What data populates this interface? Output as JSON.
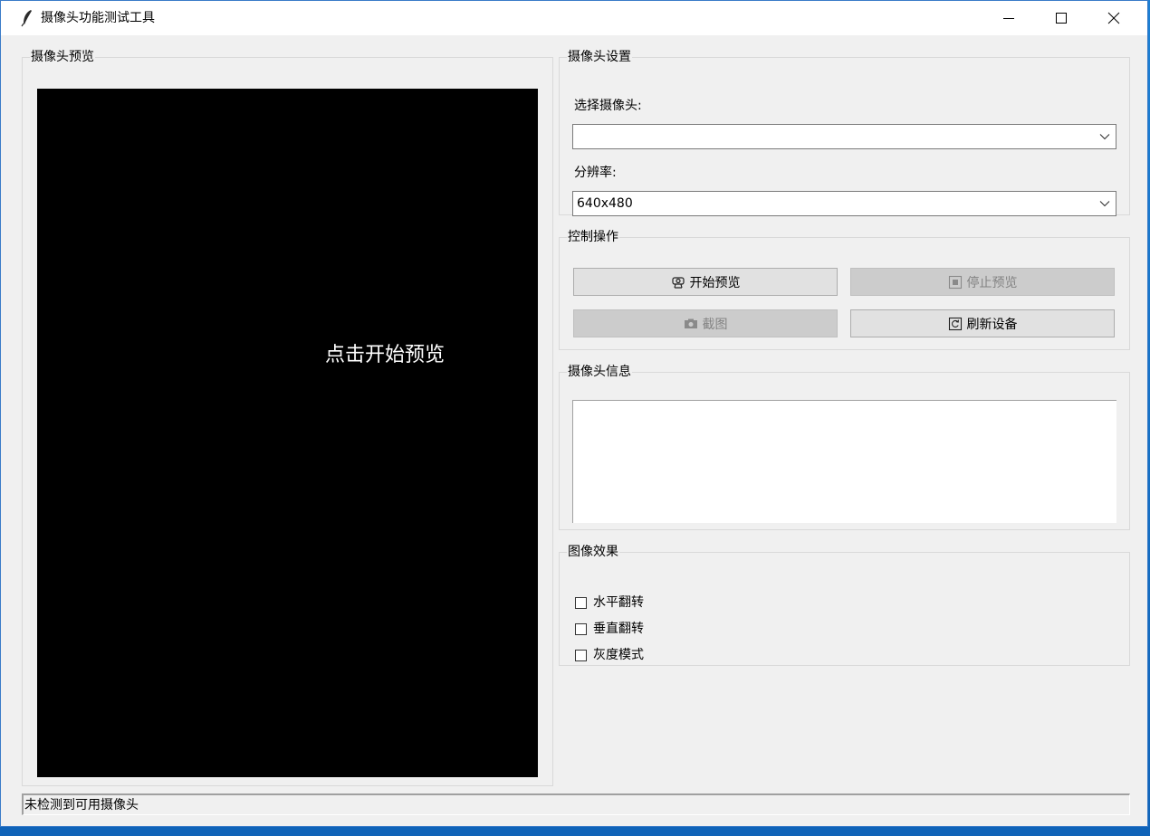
{
  "window": {
    "title": "摄像头功能测试工具",
    "icon": "feather-icon"
  },
  "preview": {
    "group_label": "摄像头预览",
    "hint": "点击开始预览"
  },
  "settings": {
    "group_label": "摄像头设置",
    "camera_label": "选择摄像头:",
    "camera_value": "",
    "resolution_label": "分辨率:",
    "resolution_value": "640x480"
  },
  "controls": {
    "group_label": "控制操作",
    "start_label": "开始预览",
    "stop_label": "停止预览",
    "capture_label": "截图",
    "refresh_label": "刷新设备"
  },
  "info": {
    "group_label": "摄像头信息",
    "content": ""
  },
  "effects": {
    "group_label": "图像效果",
    "items": [
      {
        "label": "水平翻转",
        "checked": false
      },
      {
        "label": "垂直翻转",
        "checked": false
      },
      {
        "label": "灰度模式",
        "checked": false
      }
    ]
  },
  "status": {
    "text": "未检测到可用摄像头"
  }
}
